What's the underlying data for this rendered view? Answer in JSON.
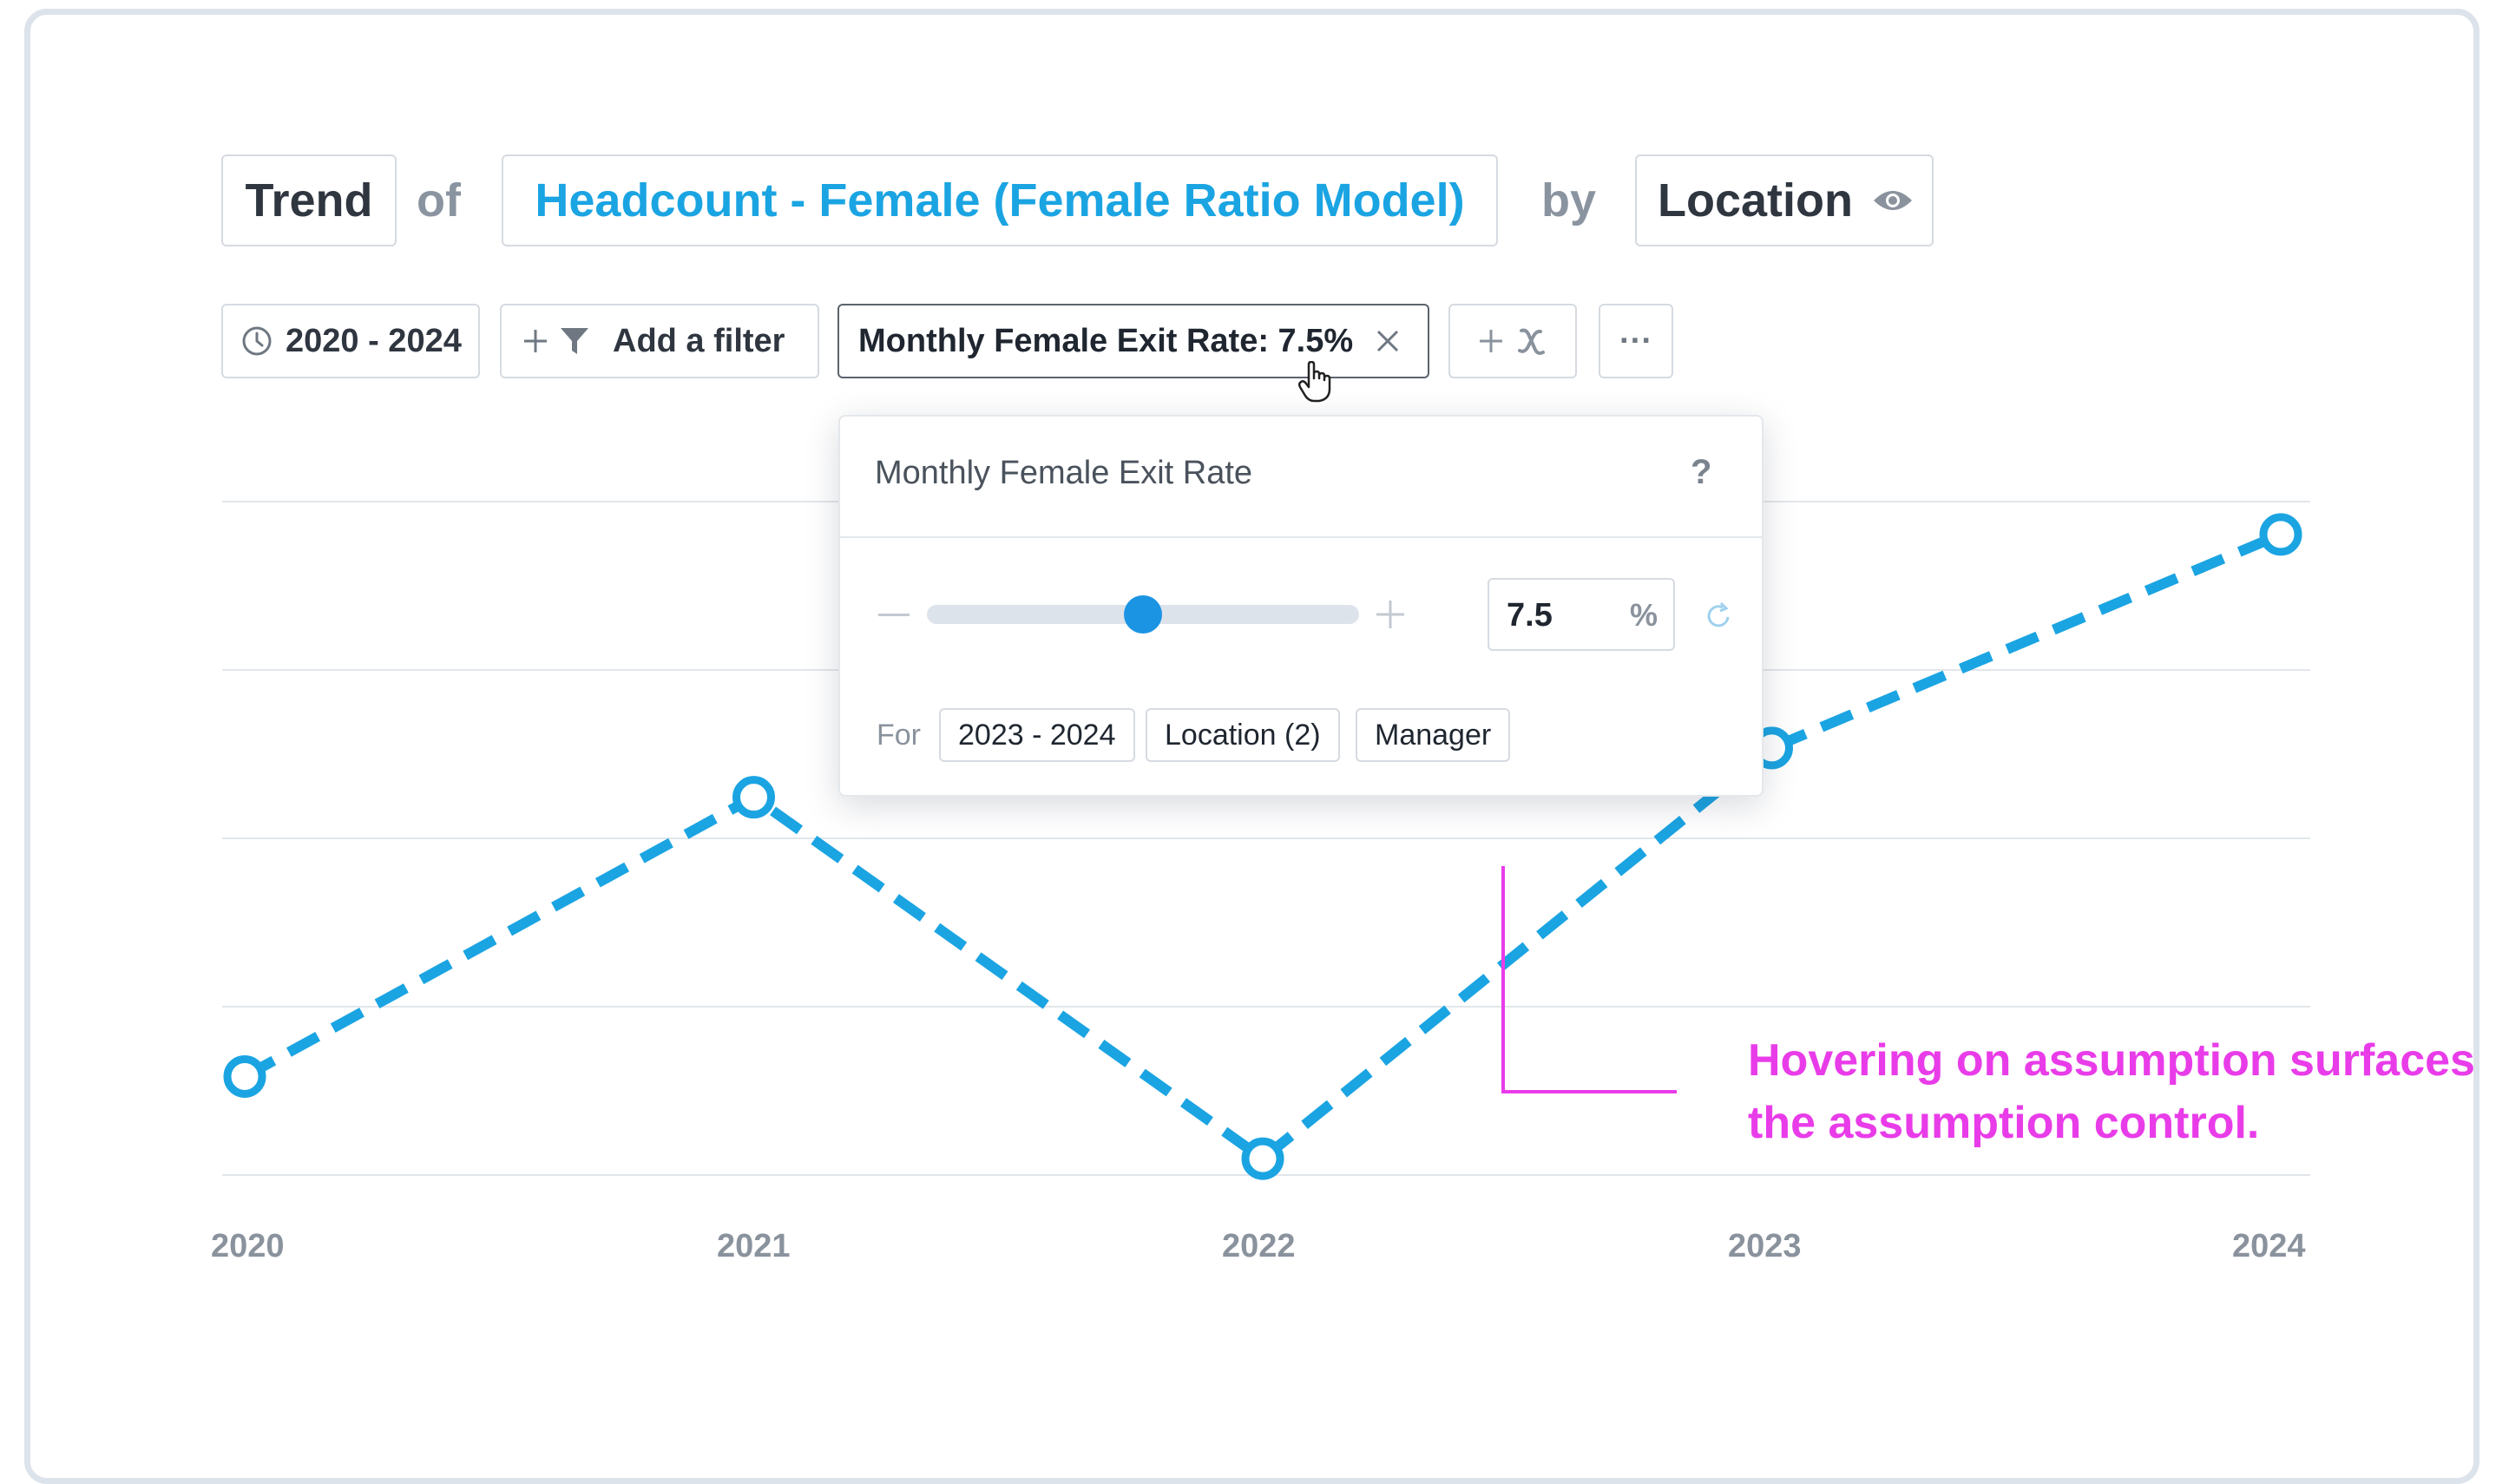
{
  "query": {
    "mode": "Trend",
    "of_word": "of",
    "metric": "Headcount - Female (Female Ratio Model)",
    "by_word": "by",
    "dimension": "Location",
    "dimension_icon": "eye-icon"
  },
  "toolbar": {
    "date_range": "2020 - 2024",
    "date_icon": "clock-icon",
    "add_filter": "Add a filter",
    "filter_icon": "funnel-icon",
    "assumption_chip": "Monthly Female Exit Rate: 7.5%",
    "more": "···"
  },
  "popover": {
    "title": "Monthly Female Exit Rate",
    "help": "?",
    "value": "7.5",
    "unit": "%",
    "slider_fraction": 0.5,
    "for_label": "For",
    "chips": [
      "2023 - 2024",
      "Location (2)",
      "Manager"
    ]
  },
  "annotation": {
    "line1": "Hovering on assumption surfaces",
    "line2": "the assumption control."
  },
  "colors": {
    "accent": "#1ba4e2",
    "annotation": "#e93ce9",
    "grid": "#e2e6ea"
  },
  "chart_data": {
    "type": "line",
    "categories": [
      "2020",
      "2021",
      "2022",
      "2023",
      "2024"
    ],
    "values": [
      0.6,
      2.3,
      0.1,
      2.6,
      3.9
    ],
    "ylim": [
      0,
      4.1
    ],
    "grid": true,
    "line_style": "dashed"
  }
}
